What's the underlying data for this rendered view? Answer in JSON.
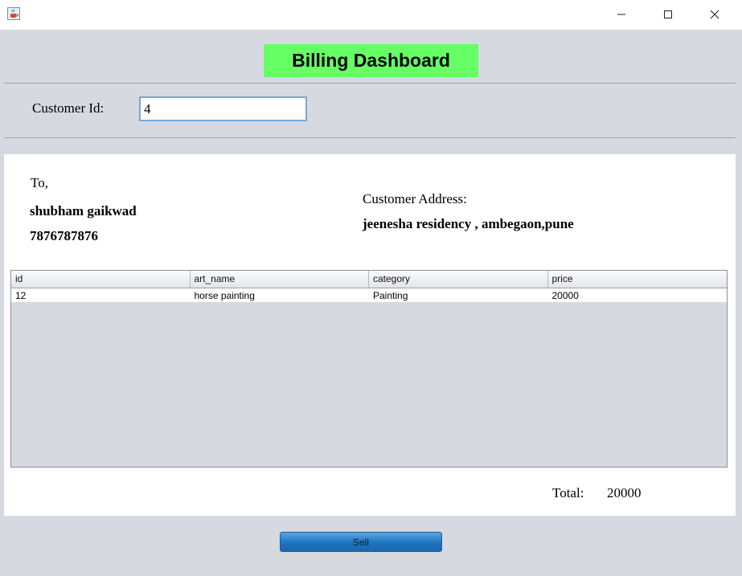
{
  "window": {
    "app_icon": "java-cup-icon",
    "minimize_icon": "minimize-icon",
    "maximize_icon": "maximize-icon",
    "close_icon": "close-icon"
  },
  "header": {
    "title": "Billing Dashboard",
    "title_bg": "#66ff66"
  },
  "customer_search": {
    "label": "Customer Id:",
    "value": "4"
  },
  "bill": {
    "to_label": "To,",
    "customer_name": "shubham gaikwad",
    "customer_phone": "7876787876",
    "address_label": "Customer Address:",
    "address_value": "jeenesha residency , ambegaon,pune"
  },
  "table": {
    "columns": [
      "id",
      "art_name",
      "category",
      "price"
    ],
    "rows": [
      [
        "12",
        "horse painting",
        "Painting",
        "20000"
      ]
    ]
  },
  "total": {
    "label": "Total:",
    "value": "20000"
  },
  "actions": {
    "sell_label": "Sell",
    "sell_color": "#1d74c0"
  }
}
